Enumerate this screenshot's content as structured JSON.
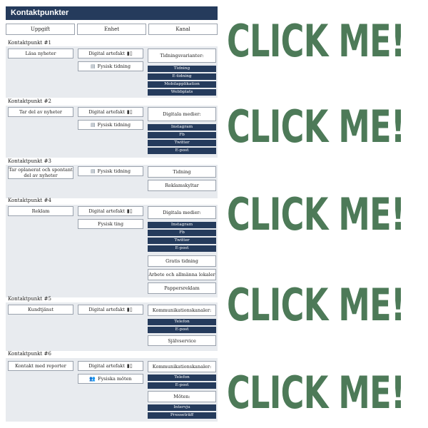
{
  "title": "Kontaktpunkter",
  "columns": [
    "Uppgift",
    "Enhet",
    "Kanal"
  ],
  "sections": [
    {
      "label": "Kontaktpunkt #1",
      "task": "Läsa nyheter",
      "devices": [
        "Digital artefakt",
        "Fysisk tidning"
      ],
      "channel_header": "Tidningsvarianter:",
      "channels": [
        "Tidning",
        "E-tidning",
        "Mobilapplikation",
        "Webbplats"
      ]
    },
    {
      "label": "Kontaktpunkt #2",
      "task": "Tar del av nyheter",
      "devices": [
        "Digital artefakt",
        "Fysisk tidning"
      ],
      "channel_header": "Digitala medier:",
      "channels": [
        "Instagram",
        "Fb",
        "Twitter",
        "E-post"
      ]
    },
    {
      "label": "Kontaktpunkt #3",
      "task": "Tar oplanerat och spontant del av nyheter",
      "devices": [
        "Fysisk tidning"
      ],
      "channel_boxes": [
        "Tidning",
        "Reklamskyltar"
      ]
    },
    {
      "label": "Kontaktpunkt #4",
      "task": "Reklam",
      "devices": [
        "Digital artefakt",
        "Fysisk ting"
      ],
      "channel_header": "Digitala medier:",
      "channels": [
        "Instagram",
        "Fb",
        "Twitter",
        "E-post"
      ],
      "channel_boxes": [
        "Gratis tidning",
        "Arbete och allmänna lokaler",
        "Pappersreklam"
      ]
    },
    {
      "label": "Kontaktpunkt #5",
      "task": "Kundtjänst",
      "devices": [
        "Digital artefakt"
      ],
      "channel_header": "Kommunikationskanaler:",
      "channels": [
        "Telefon",
        "E-post"
      ],
      "channel_boxes": [
        "Självservice"
      ]
    },
    {
      "label": "Kontaktpunkt #6",
      "task": "Kontakt med reporter",
      "devices": [
        "Digital artefakt",
        "Fysiska möten"
      ],
      "channel_header": "Kommunikationskanaler:",
      "channels": [
        "Telefon",
        "E-post"
      ],
      "channel_header2": "Möten:",
      "channels2": [
        "Intervju",
        "Presseträff"
      ]
    }
  ],
  "cta_label": "CLICK ME!",
  "icons": {
    "digital": "phone-tablet-icon",
    "physical": "newspaper-icon",
    "meeting": "people-icon"
  },
  "colors": {
    "navy": "#253b5c",
    "section_bg": "#e8ebef",
    "cta": "#4d7a58"
  }
}
